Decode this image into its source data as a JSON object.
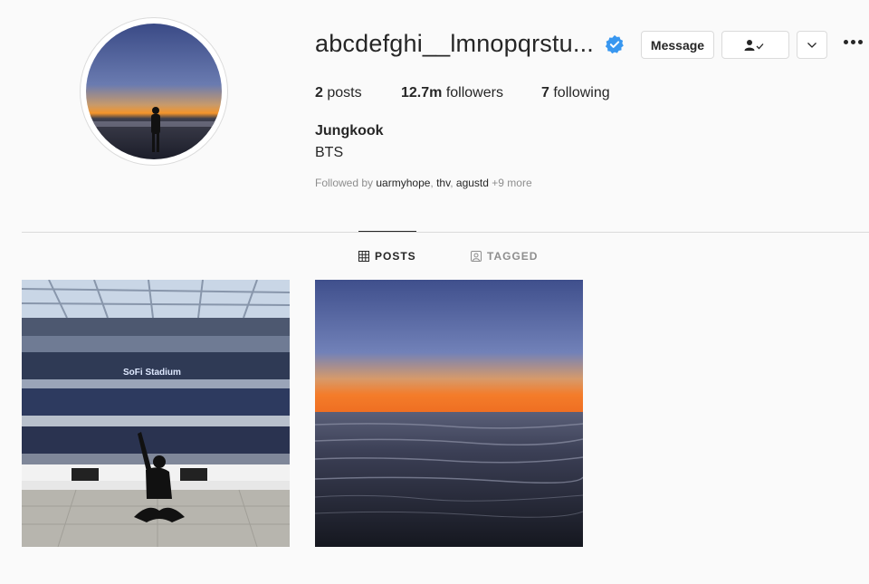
{
  "profile": {
    "username": "abcdefghi__lmnopqrstu...",
    "full_name": "Jungkook",
    "bio": "BTS",
    "posts_count": "2",
    "posts_label": "posts",
    "followers_count": "12.7m",
    "followers_label": "followers",
    "following_count": "7",
    "following_label": "following",
    "followed_by": {
      "prefix": "Followed by",
      "users": [
        "uarmyhope",
        "thv",
        "agustd"
      ],
      "more": "+9 more"
    }
  },
  "actions": {
    "message_label": "Message",
    "follow_icon": "person-check-icon",
    "more_icon": "chevron-down-icon",
    "options_icon": "more-dots-icon"
  },
  "tabs": [
    {
      "label": "POSTS",
      "icon": "grid-icon",
      "active": true
    },
    {
      "label": "TAGGED",
      "icon": "tag-person-icon",
      "active": false
    }
  ],
  "posts": [
    {
      "caption_visible_text": "SoFi Stadium"
    },
    {}
  ],
  "colors": {
    "verified": "#3897f0",
    "border": "#dbdbdb",
    "muted": "#8e8e8e",
    "text": "#262626"
  }
}
